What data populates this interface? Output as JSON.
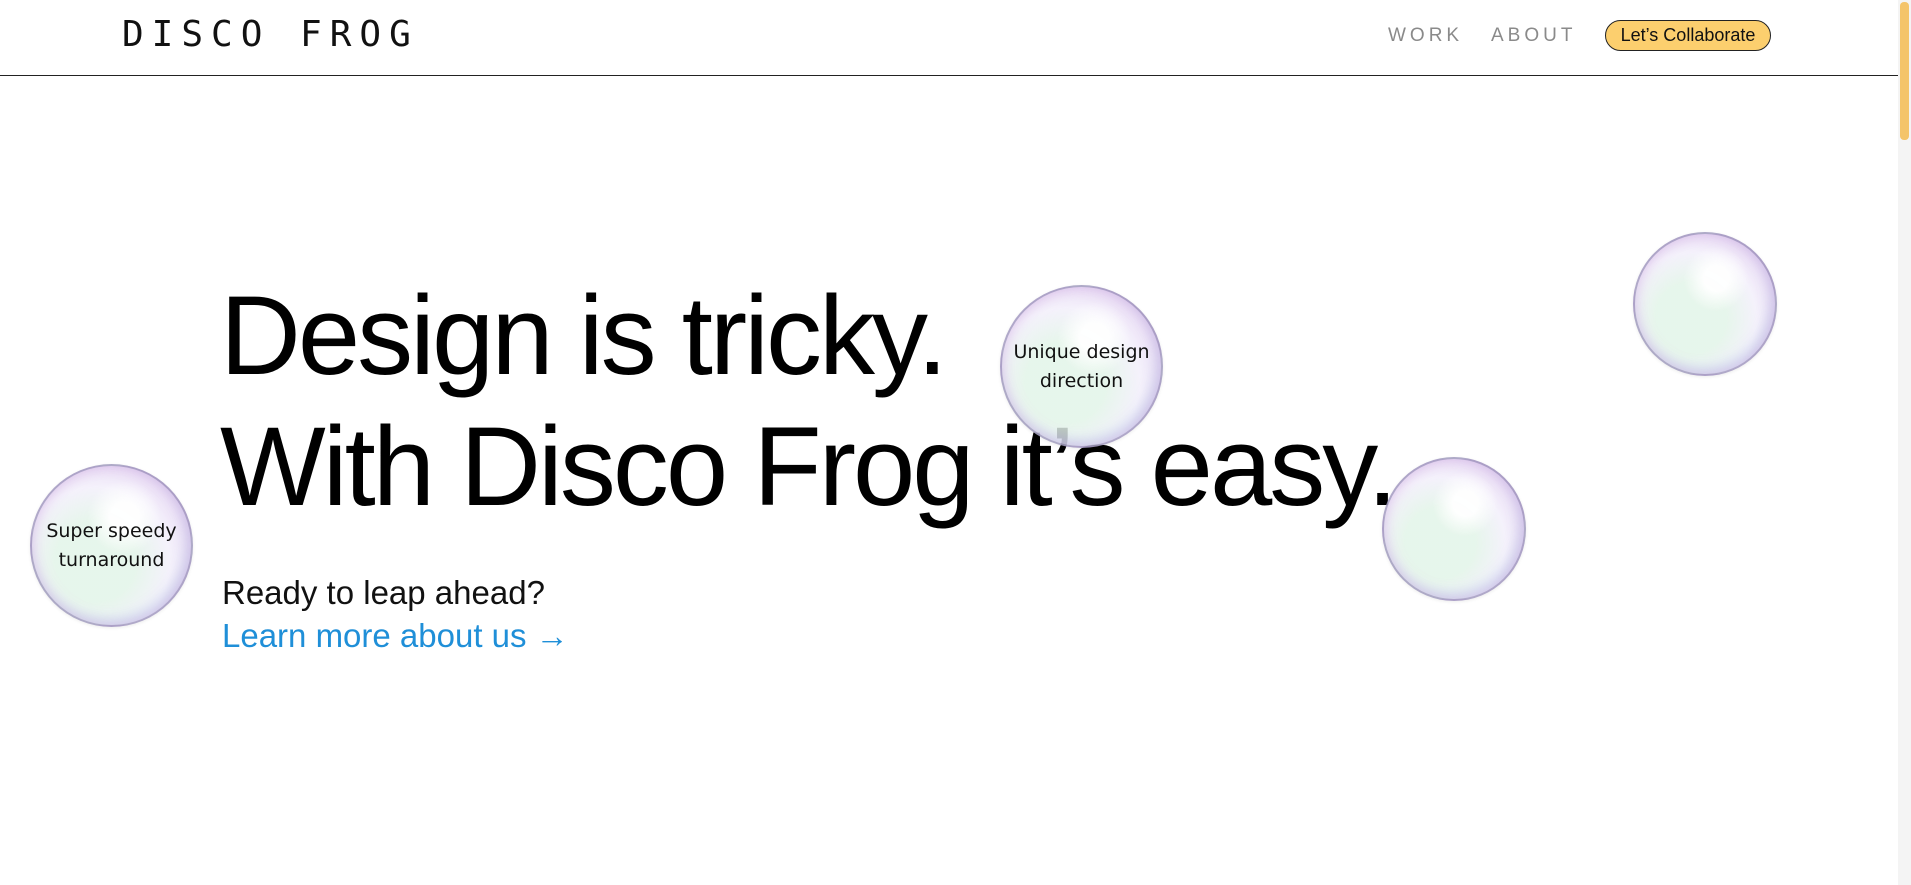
{
  "header": {
    "logo": "DISCO FROG",
    "nav": {
      "work": "WORK",
      "about": "ABOUT"
    },
    "cta_label": "Let’s Collaborate"
  },
  "hero": {
    "headline_line1": "Design is tricky.",
    "headline_line2": "With Disco Frog it’s easy.",
    "subtext": "Ready to leap ahead?",
    "link_label": "Learn more about us →"
  },
  "bubbles": [
    {
      "text_line1": "Super speedy",
      "text_line2": "turnaround"
    },
    {
      "text_line1": "Unique design",
      "text_line2": "direction"
    },
    {
      "text_line1": "",
      "text_line2": ""
    },
    {
      "text_line1": "",
      "text_line2": ""
    }
  ],
  "colors": {
    "accent_cta": "#fccf6e",
    "link": "#1f8fd8",
    "nav_text": "#8a8a8a",
    "scroll_thumb": "#f4c46a"
  }
}
